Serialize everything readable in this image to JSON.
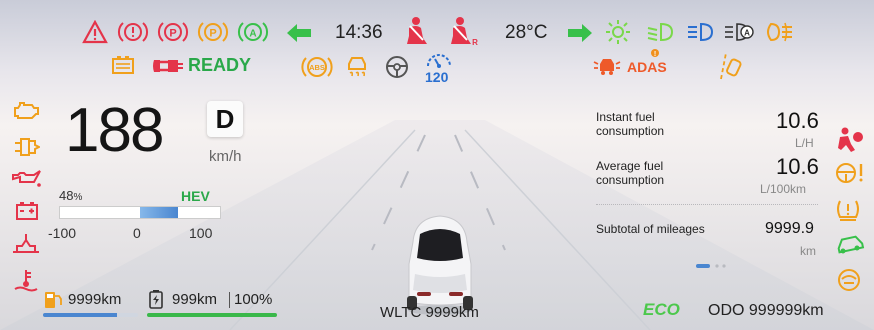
{
  "top": {
    "time": "14:36",
    "temperature": "28°C"
  },
  "status": {
    "ready": "READY",
    "adas": "ADAS",
    "speed_limit_badge": "120"
  },
  "icons": {
    "top_left": [
      "warning-triangle-icon",
      "brake-warning-icon",
      "parking-brake-red-icon",
      "parking-brake-orange-icon",
      "auto-hold-icon",
      "turn-left-arrow-icon"
    ],
    "top_right": [
      "turn-right-arrow-icon",
      "position-light-icon",
      "low-beam-icon",
      "high-beam-icon",
      "auto-high-beam-icon",
      "fog-light-icon"
    ],
    "left_column": [
      "engine-check-icon",
      "transmission-icon",
      "oil-pressure-icon",
      "battery-icon",
      "coolant-icon",
      "coolant-temp-icon"
    ],
    "right_column": [
      "airbag-icon",
      "steering-fault-icon",
      "tire-pressure-icon",
      "traction-off-icon",
      "brake-assist-icon"
    ]
  },
  "speed": {
    "value": "188",
    "unit": "km/h",
    "gear": "D"
  },
  "power": {
    "percent": "48",
    "percent_suffix": "%",
    "mode": "HEV",
    "level_fraction": 0.48,
    "scale": [
      "-100",
      "0",
      "100"
    ]
  },
  "range": {
    "fuel": "9999",
    "fuel_unit": "km",
    "electric": "999",
    "electric_unit": "km",
    "battery": "100%",
    "fuel_fraction": 0.78,
    "battery_fraction": 1.0
  },
  "consumption": {
    "instant_label_line1": "Instant fuel",
    "instant_label_line2": "consumption",
    "instant_value": "10.6",
    "instant_unit": "L/H",
    "average_label_line1": "Average fuel",
    "average_label_line2": "consumption",
    "average_value": "10.6",
    "average_unit": "L/100km",
    "subtotal_label": "Subtotal of mileages",
    "subtotal_value": "9999.9",
    "subtotal_unit": "km"
  },
  "footer": {
    "wltc": "WLTC 9999km",
    "eco": "ECO",
    "odo": "ODO 999999km"
  },
  "colors": {
    "red": "#e4344a",
    "orange": "#f0901c",
    "green": "#38c04a",
    "blue": "#2a6fd0"
  }
}
